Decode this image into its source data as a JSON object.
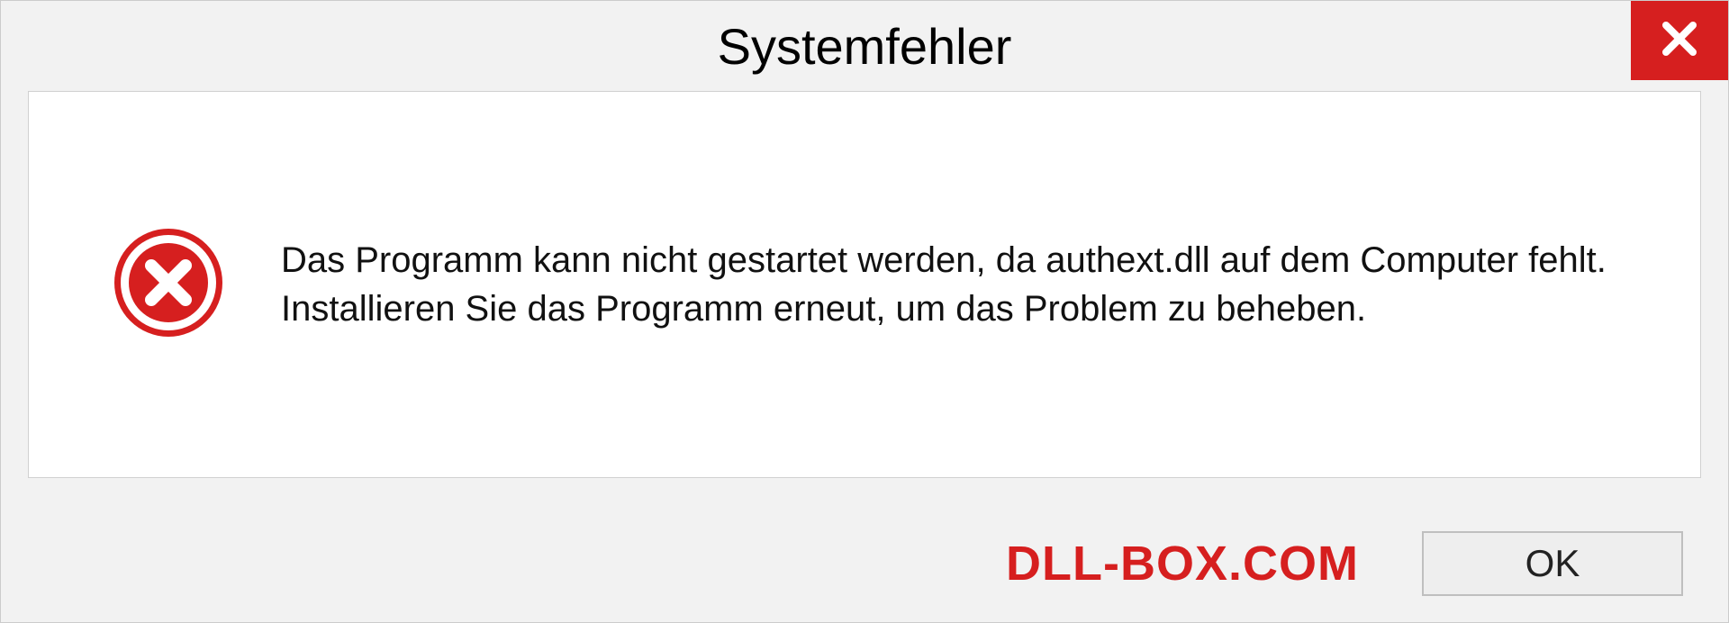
{
  "dialog": {
    "title": "Systemfehler",
    "message": "Das Programm kann nicht gestartet werden, da authext.dll auf dem Computer fehlt. Installieren Sie das Programm erneut, um das Problem zu beheben.",
    "ok_label": "OK"
  },
  "watermark": "DLL-BOX.COM"
}
